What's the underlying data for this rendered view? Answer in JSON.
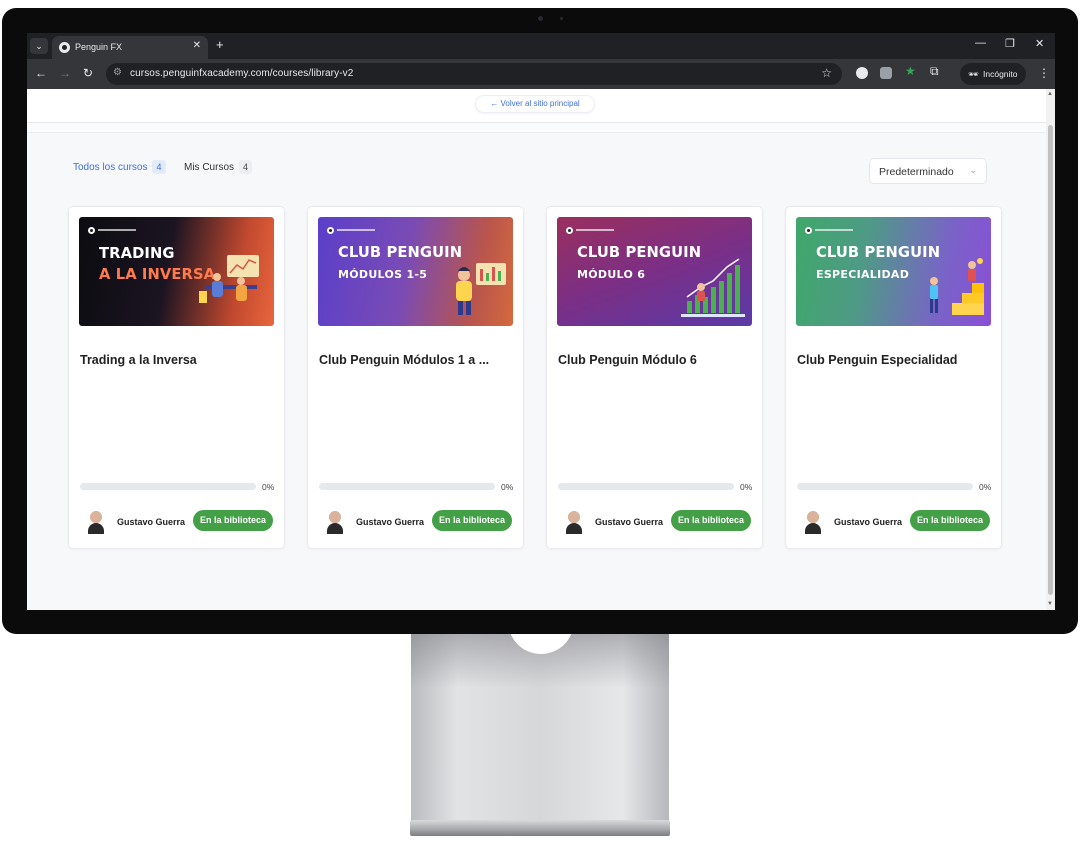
{
  "browser": {
    "tab_title": "Penguin FX",
    "url": "cursos.penguinfxacademy.com/courses/library-v2",
    "incognito_label": "Incógnito"
  },
  "page": {
    "back_link": "← Volver al sitio principal",
    "tabs": [
      {
        "label": "Todos los cursos",
        "count": "4",
        "active": true
      },
      {
        "label": "Mis Cursos",
        "count": "4",
        "active": false
      }
    ],
    "sort_value": "Predeterminado"
  },
  "courses": [
    {
      "thumb_line1": "TRADING",
      "thumb_line2": "A LA INVERSA",
      "thumb_sub": "",
      "title": "Trading a la Inversa",
      "progress_label": "0%",
      "progress": 0,
      "author": "Gustavo Guerra",
      "button": "En la biblioteca"
    },
    {
      "thumb_line1": "CLUB PENGUIN",
      "thumb_line2": "",
      "thumb_sub": "MÓDULOS 1-5",
      "title": "Club Penguin Módulos 1 a ...",
      "progress_label": "0%",
      "progress": 0,
      "author": "Gustavo Guerra",
      "button": "En la biblioteca"
    },
    {
      "thumb_line1": "CLUB PENGUIN",
      "thumb_line2": "",
      "thumb_sub": "MÓDULO 6",
      "title": "Club Penguin Módulo 6",
      "progress_label": "0%",
      "progress": 0,
      "author": "Gustavo Guerra",
      "button": "En la biblioteca"
    },
    {
      "thumb_line1": "CLUB PENGUIN",
      "thumb_line2": "",
      "thumb_sub": "ESPECIALIDAD",
      "title": "Club Penguin Especialidad",
      "progress_label": "0%",
      "progress": 0,
      "author": "Gustavo Guerra",
      "button": "En la biblioteca"
    }
  ],
  "colors": {
    "accent": "#3f6fd8",
    "button_green": "#43a047",
    "thumb1": "#e8663d",
    "thumb2": "#6a4bc4",
    "thumb3": "#8b2f6e",
    "thumb4": "#3fa86a"
  }
}
